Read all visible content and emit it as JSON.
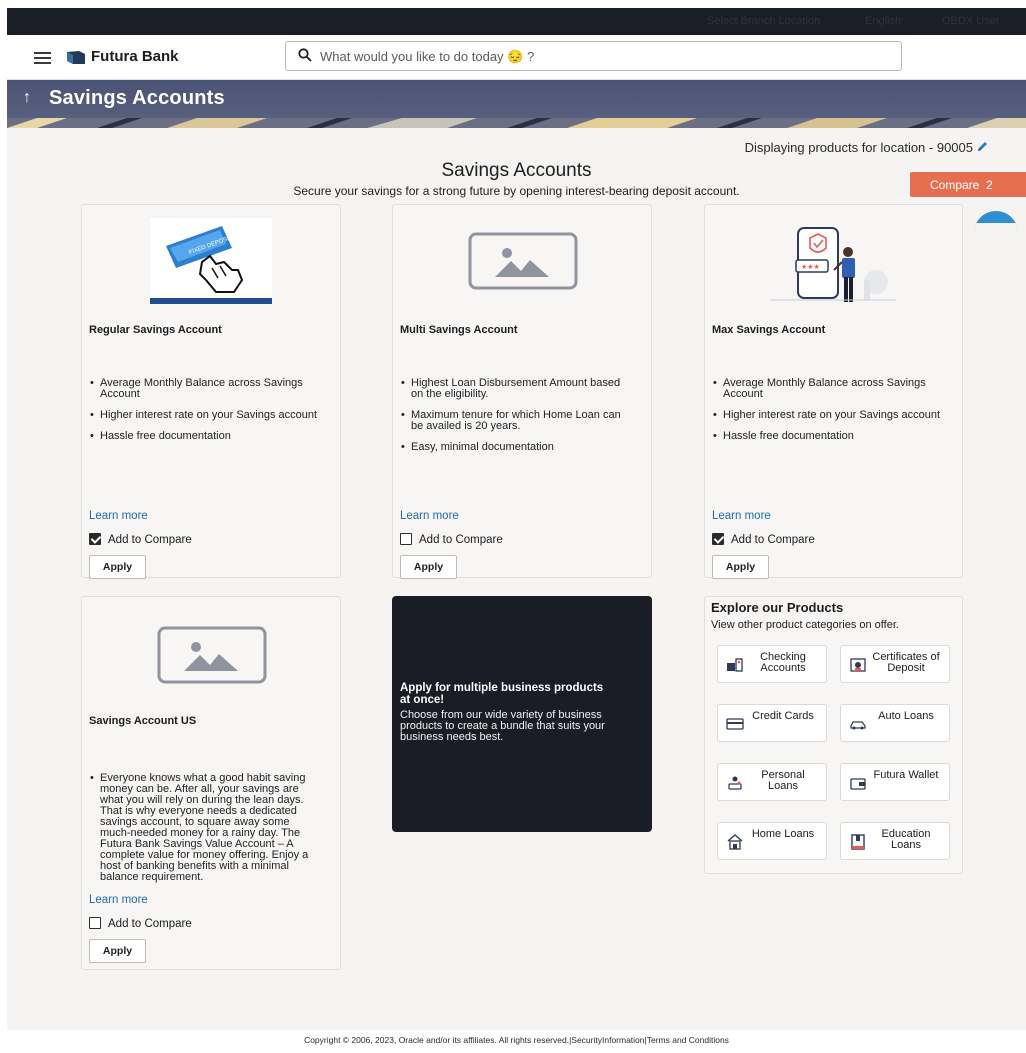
{
  "header": {
    "brand": "Futura Bank",
    "search_placeholder": "What would you like to do today 😔 ?"
  },
  "topbar": {
    "items": [
      "Select Branch Location",
      "English",
      "OBDX User"
    ]
  },
  "banner": {
    "title": "Savings Accounts"
  },
  "location_text": "Displaying products for location - 90005",
  "page": {
    "heading": "Savings Accounts",
    "subheading": "Secure your savings for a strong future by opening interest-bearing deposit account."
  },
  "compare": {
    "label": "Compare",
    "count": "2"
  },
  "cards": [
    {
      "name": "Regular Savings Account",
      "features": [
        "Average Monthly Balance across Savings Account",
        "Higher interest rate on your Savings account",
        "Hassle free documentation"
      ],
      "learn_more": "Learn more",
      "compare_label": "Add to Compare",
      "compared": true,
      "apply": "Apply",
      "image_text": "FIXED DEPOSIT"
    },
    {
      "name": "Multi Savings Account",
      "features": [
        "Highest Loan Disbursement Amount based on the eligibility.",
        "Maximum tenure for which Home Loan can be availed is 20 years.",
        "Easy, minimal documentation"
      ],
      "learn_more": "Learn more",
      "compare_label": "Add to Compare",
      "compared": false,
      "apply": "Apply"
    },
    {
      "name": "Max Savings Account",
      "features": [
        "Average Monthly Balance across Savings Account",
        "Higher interest rate on your Savings account",
        "Hassle free documentation"
      ],
      "learn_more": "Learn more",
      "compare_label": "Add to Compare",
      "compared": true,
      "apply": "Apply"
    },
    {
      "name": "Savings Account US",
      "features": [
        "Everyone knows what a good habit saving money can be. After all, your savings are what you will rely on during the lean days. That is why everyone needs a dedicated savings account, to square away some much-needed money for a rainy day. The Futura Bank Savings Value Account – A complete value for money offering. Enjoy a host of banking benefits with a minimal balance requirement."
      ],
      "learn_more": "Learn more",
      "compare_label": "Add to Compare",
      "compared": false,
      "apply": "Apply"
    }
  ],
  "promo": {
    "title": "Apply for multiple business products at once!",
    "text": "Choose from our wide variety of business products to create a bundle that suits your business needs best."
  },
  "explore": {
    "title": "Explore our Products",
    "subtitle": "View other product categories on offer.",
    "products": [
      {
        "label": "Checking Accounts",
        "icon": "checking-icon"
      },
      {
        "label": "Certificates of Deposit",
        "icon": "certificate-icon"
      },
      {
        "label": "Credit Cards",
        "icon": "credit-card-icon"
      },
      {
        "label": "Auto Loans",
        "icon": "car-icon"
      },
      {
        "label": "Personal Loans",
        "icon": "personal-loan-icon"
      },
      {
        "label": "Futura Wallet",
        "icon": "wallet-icon"
      },
      {
        "label": "Home Loans",
        "icon": "home-icon"
      },
      {
        "label": "Education Loans",
        "icon": "book-icon"
      }
    ]
  },
  "footer": {
    "text": "Copyright © 2006, 2023, Oracle and/or its affiliates. All rights reserved.|SecurityInformation|Terms and Conditions"
  },
  "colors": {
    "accent": "#e76f51",
    "banner": "#4b5475",
    "link": "#1f6bad",
    "topbar": "#1b1e26"
  }
}
